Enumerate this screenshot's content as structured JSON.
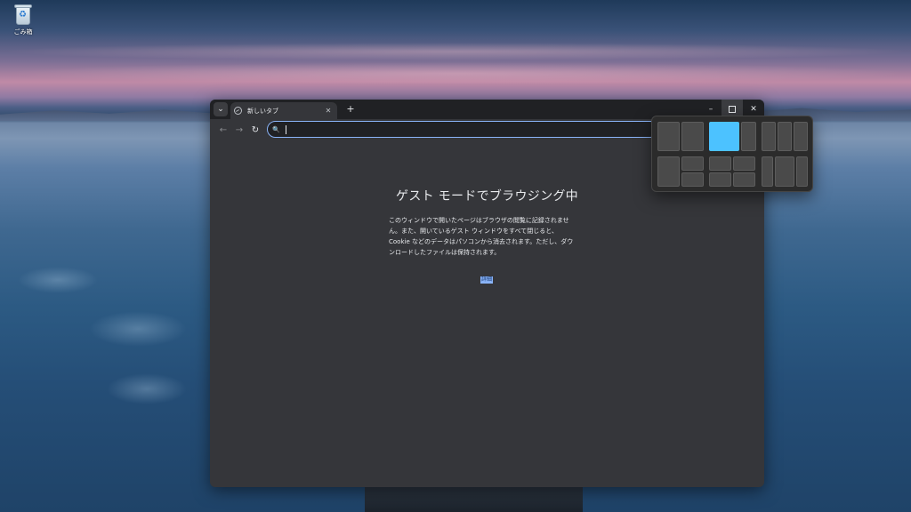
{
  "desktop": {
    "recycle_bin_label": "ごみ箱"
  },
  "browser": {
    "tab": {
      "title": "新しいタブ",
      "close_glyph": "✕"
    },
    "new_tab_glyph": "+",
    "tab_search_glyph": "⌄",
    "window_controls": {
      "minimize_glyph": "–",
      "close_glyph": "✕"
    },
    "nav": {
      "back_glyph": "←",
      "forward_glyph": "→",
      "reload_glyph": "↻"
    },
    "omnibox": {
      "icon_glyph": "🔍",
      "value": ""
    },
    "guest": {
      "heading": "ゲスト モードでブラウジング中",
      "lines": [
        "このウィンドウで開いたページはブラウザの閲覧に記録されませ",
        "ん。また、開いているゲスト ウィンドウをすべて閉じると、",
        "Cookie などのデータはパソコンから消去されます。ただし、ダウ",
        "ンロードしたファイルは保持されます。"
      ],
      "learn_more": "詳細"
    }
  },
  "snap_layouts": {
    "active_layout": "layout-2",
    "active_zone": "left-wide"
  },
  "colors": {
    "accent": "#8ab4f8",
    "snap_active": "#4cc2ff",
    "window_bg": "#35363a",
    "titlebar_bg": "#202124"
  }
}
